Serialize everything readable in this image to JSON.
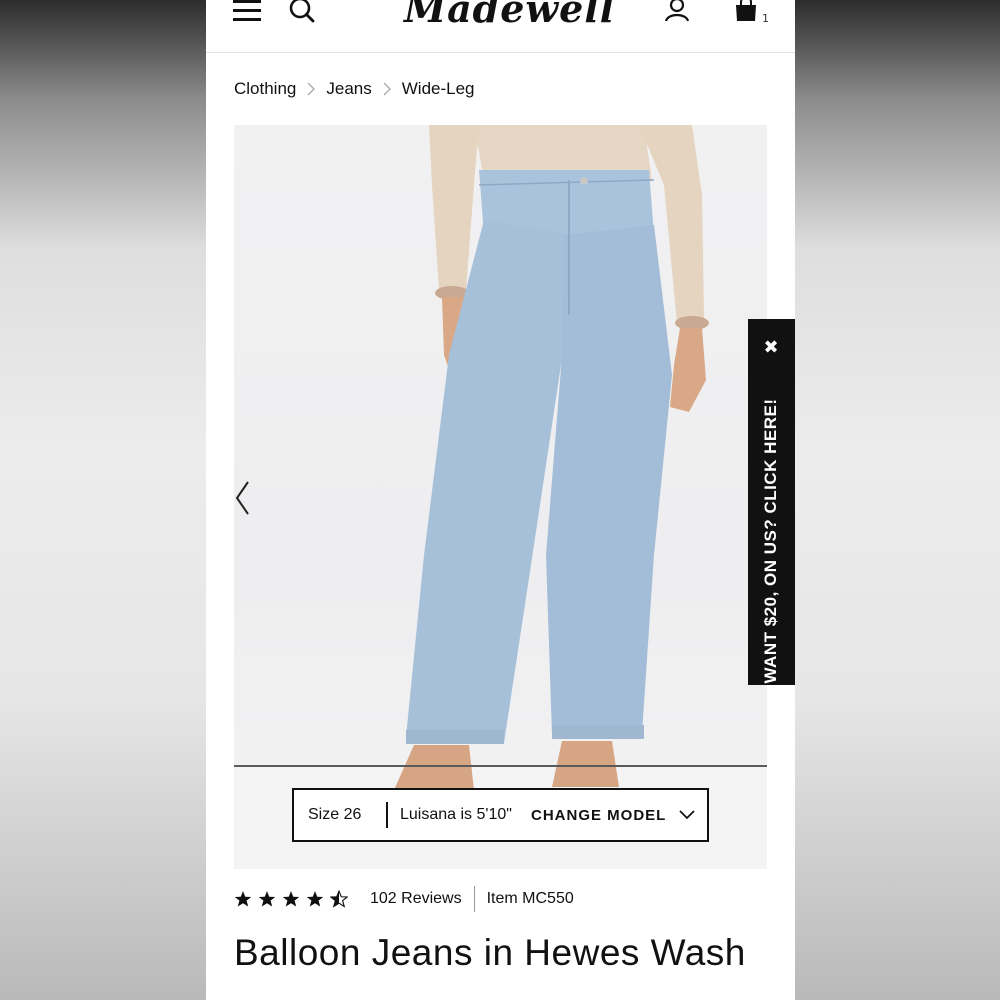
{
  "header": {
    "brand": "Madewell",
    "bag_count": "1"
  },
  "breadcrumb": [
    "Clothing",
    "Jeans",
    "Wide-Leg"
  ],
  "model_bar": {
    "size": "Size 26",
    "model": "Luisana is 5'10\"",
    "change_label": "CHANGE MODEL"
  },
  "promo": {
    "text": "WANT $20, ON US? CLICK HERE!",
    "close_symbol": "✖"
  },
  "product": {
    "rating": 4.5,
    "reviews": "102 Reviews",
    "item": "Item MC550",
    "title": "Balloon Jeans in Hewes Wash"
  },
  "colors": {
    "text": "#111111",
    "denim": "#a9c3dd",
    "sweater": "#e8d8c4"
  },
  "icons": [
    "menu-icon",
    "search-icon",
    "account-icon",
    "bag-icon",
    "chevron-right-icon",
    "chevron-left-icon",
    "chevron-down-icon",
    "close-icon",
    "star-icon",
    "star-half-icon"
  ]
}
